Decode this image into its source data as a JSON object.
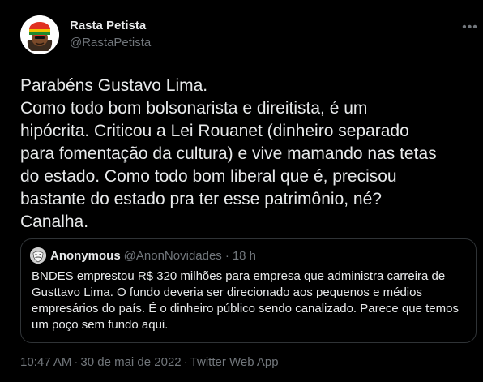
{
  "author": {
    "name": "Rasta Petista",
    "handle": "@RastaPetista",
    "avatar_icon": "rastafarian-emoji-avatar"
  },
  "more_icon": "more-options-icon",
  "tweet": {
    "lines": [
      "Parabéns Gustavo Lima.",
      "Como todo bom bolsonarista e direitista, é um",
      "hipócrita. Criticou a Lei Rouanet (dinheiro separado",
      "para fomentação da cultura) e vive mamando nas tetas",
      "do estado. Como todo bom liberal que é, precisou",
      "bastante do estado pra ter esse patrimônio, né?",
      "Canalha."
    ]
  },
  "quoted": {
    "name": "Anonymous",
    "handle": "@AnonNovidades",
    "separator": "·",
    "time": "18 h",
    "avatar_icon": "anonymous-mask-avatar",
    "lines": [
      "BNDES emprestou R$ 320 milhões para empresa que administra carreira de",
      "Gusttavo Lima. O fundo deveria ser direcionado aos pequenos e médios",
      "empresários do país. É o dinheiro público sendo canalizado. Parece que temos",
      "um poço sem fundo aqui."
    ]
  },
  "meta": {
    "time": "10:47 AM",
    "separator": "·",
    "date": "30 de mai de 2022",
    "source": "Twitter Web App"
  },
  "colors": {
    "background": "#000000",
    "text": "#e7e9ea",
    "secondary": "#71767b",
    "border": "#2f3336"
  }
}
